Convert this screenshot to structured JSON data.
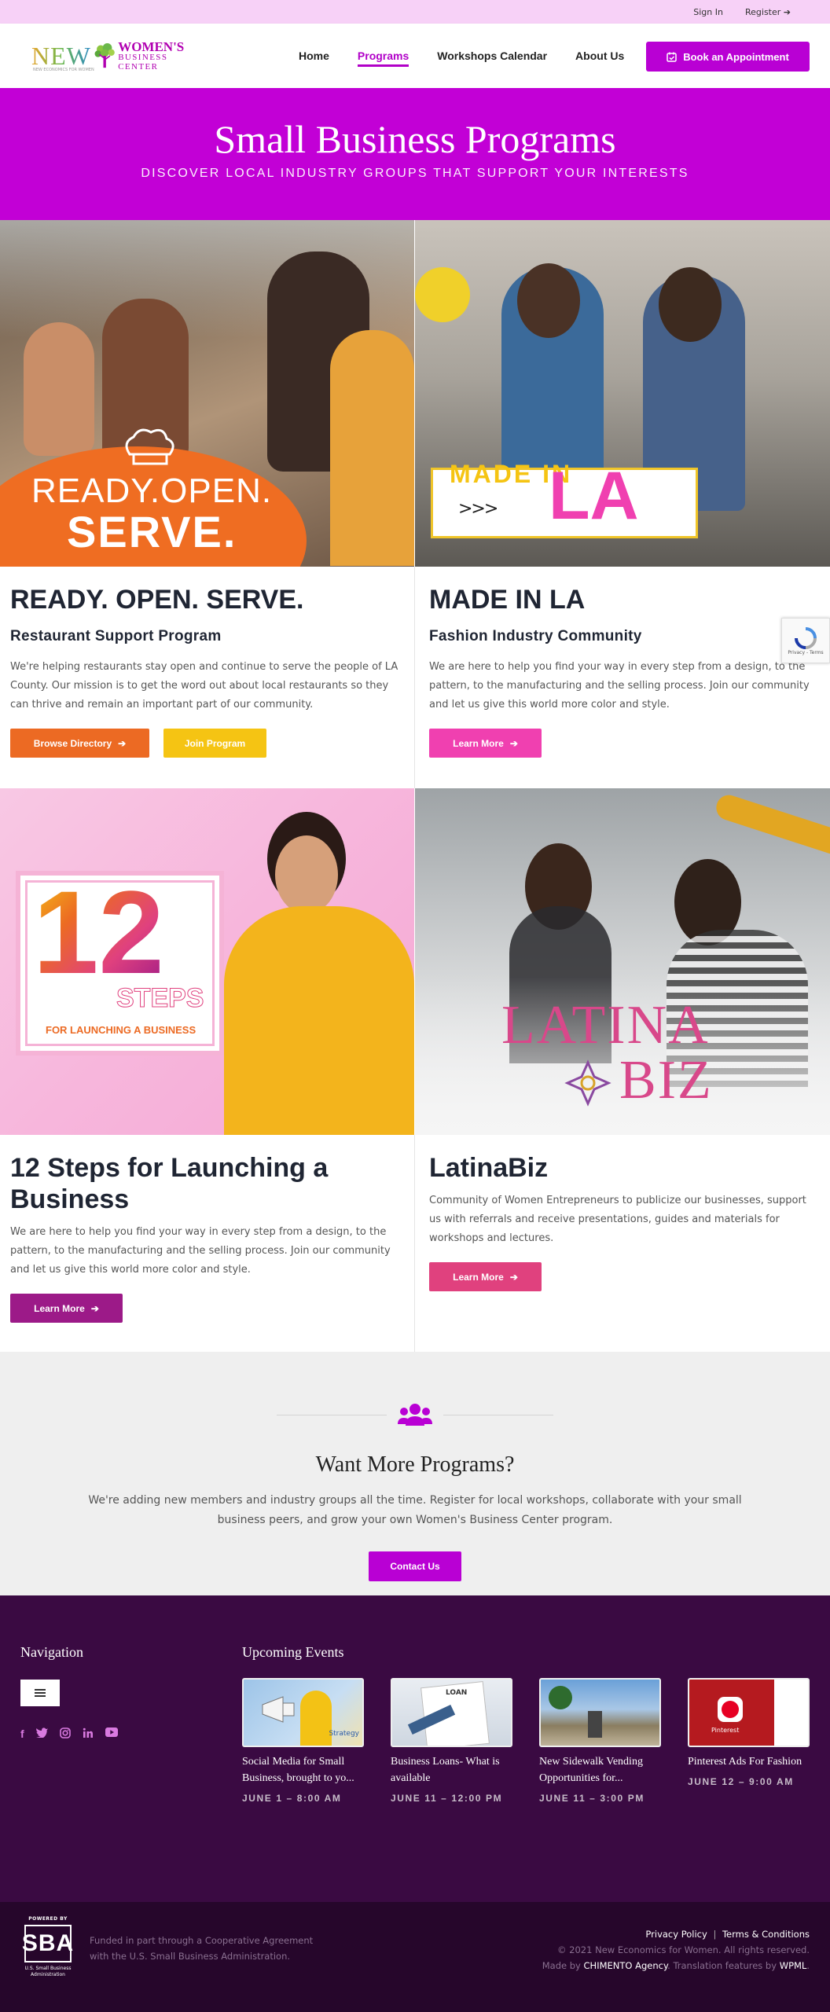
{
  "topbar": {
    "sign_in": "Sign In",
    "register": "Register"
  },
  "logo": {
    "new": "NEW",
    "womens": "WOMEN'S",
    "business_center": "BUSINESS CENTER",
    "sub": "NEW ECONOMICS FOR WOMEN"
  },
  "nav": {
    "items": [
      {
        "label": "Home"
      },
      {
        "label": "Programs"
      },
      {
        "label": "Workshops Calendar"
      },
      {
        "label": "About Us"
      }
    ],
    "book_label": "Book an Appointment"
  },
  "hero": {
    "title": "Small Business Programs",
    "subtitle": "DISCOVER LOCAL INDUSTRY GROUPS THAT SUPPORT YOUR INTERESTS"
  },
  "programs": [
    {
      "image_text_1": "READY.OPEN.",
      "image_text_2": "SERVE.",
      "title": "READY. OPEN. SERVE.",
      "subtitle": "Restaurant Support Program",
      "body": "We're helping restaurants stay open and continue to serve the people of LA County. Our mission is to get the word out about local restaurants so they can thrive and remain an important part of our community.",
      "button1": "Browse Directory",
      "button2": "Join Program",
      "color1": "#ec6a23",
      "color2": "#f5c413"
    },
    {
      "image_text_1": "MADE IN",
      "image_text_2": "LA",
      "title": "MADE IN LA",
      "subtitle": "Fashion Industry Community",
      "body": "We are here to help you find your way in every step from a design, to the pattern, to the manufacturing and the selling process. Join our community and let us give this world more color and style.",
      "button1": "Learn More",
      "color1": "#f040b0"
    },
    {
      "image_text_1": "12",
      "image_text_2": "STEPS",
      "image_text_3": "FOR LAUNCHING A BUSINESS",
      "title": "12 Steps for Launching a Business",
      "body": "We are here to help you find your way in every step from a design, to the pattern, to the manufacturing and the selling process. Join our community and let us give this world more color and style.",
      "button1": "Learn More",
      "color1": "#9c1a88"
    },
    {
      "image_text_1": "LATINA",
      "image_text_2": "BIZ",
      "title": "LatinaBiz",
      "body": "Community of Women Entrepreneurs to publicize our businesses, support us with referrals and receive presentations, guides and materials for workshops and lectures.",
      "button1": "Learn More",
      "color1": "#e0417e"
    }
  ],
  "recaptcha": {
    "label": "Privacy - Terms"
  },
  "more": {
    "title": "Want More Programs?",
    "body": "We're adding new members and industry groups all the time. Register for local workshops, collaborate with your small business peers, and grow your own Women's Business Center program.",
    "button": "Contact Us"
  },
  "footer": {
    "nav_heading": "Navigation",
    "events_heading": "Upcoming Events",
    "events": [
      {
        "title": "Social Media for Small Business, brought to yo...",
        "date": "JUNE 1 – 8:00 AM",
        "thumb_label": "Strategy"
      },
      {
        "title": "Business Loans- What is available",
        "date": "JUNE 11 – 12:00 PM",
        "thumb_label": "LOAN"
      },
      {
        "title": "New Sidewalk Vending Opportunities for...",
        "date": "JUNE 11 – 3:00 PM"
      },
      {
        "title": "Pinterest Ads For Fashion",
        "date": "JUNE 12 – 9:00 AM",
        "thumb_label": "Pinterest"
      }
    ]
  },
  "bottom": {
    "powered_by": "POWERED BY",
    "sba": "SBA",
    "sba_sub": "U.S. Small Business Administration",
    "funding": "Funded in part through a Cooperative Agreement with the U.S. Small Business Administration.",
    "privacy": "Privacy Policy",
    "sep": "|",
    "terms": "Terms & Conditions",
    "copyright": "© 2021 New Economics for Women. All rights reserved.",
    "made_by_prefix": "Made by",
    "made_by": "CHIMENTO Agency",
    "translation_prefix": ". Translation features by",
    "translation": "WPML",
    "translation_suffix": "."
  }
}
